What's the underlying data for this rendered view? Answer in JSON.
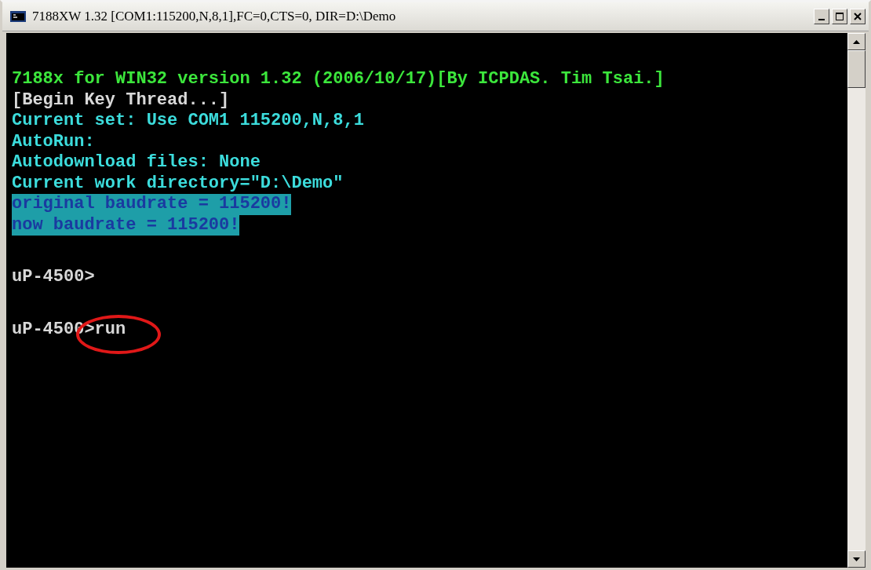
{
  "window": {
    "title": "7188XW 1.32 [COM1:115200,N,8,1],FC=0,CTS=0, DIR=D:\\Demo"
  },
  "console": {
    "lines": [
      {
        "text": "7188x for WIN32 version 1.32 (2006/10/17)[By ICPDAS. Tim Tsai.]",
        "kind": "banner",
        "spaced": false,
        "circled": false
      },
      {
        "text": "[Begin Key Thread...]",
        "kind": "plain",
        "spaced": false,
        "circled": false
      },
      {
        "text": "Current set: Use COM1 115200,N,8,1",
        "kind": "info",
        "spaced": false,
        "circled": false
      },
      {
        "text": "AutoRun:",
        "kind": "info",
        "spaced": false,
        "circled": false
      },
      {
        "text": "Autodownload files: None",
        "kind": "info",
        "spaced": false,
        "circled": false
      },
      {
        "text": "Current work directory=\"D:\\Demo\"",
        "kind": "info",
        "spaced": false,
        "circled": false
      },
      {
        "text": "original baudrate = 115200!",
        "kind": "highlight",
        "spaced": false,
        "circled": false
      },
      {
        "text": "now baudrate = 115200!",
        "kind": "highlight",
        "spaced": false,
        "circled": false
      },
      {
        "text": "uP-4500>",
        "kind": "plain",
        "spaced": true,
        "circled": false
      },
      {
        "text": "uP-4500>run",
        "kind": "plain",
        "spaced": true,
        "circled": true
      }
    ]
  }
}
